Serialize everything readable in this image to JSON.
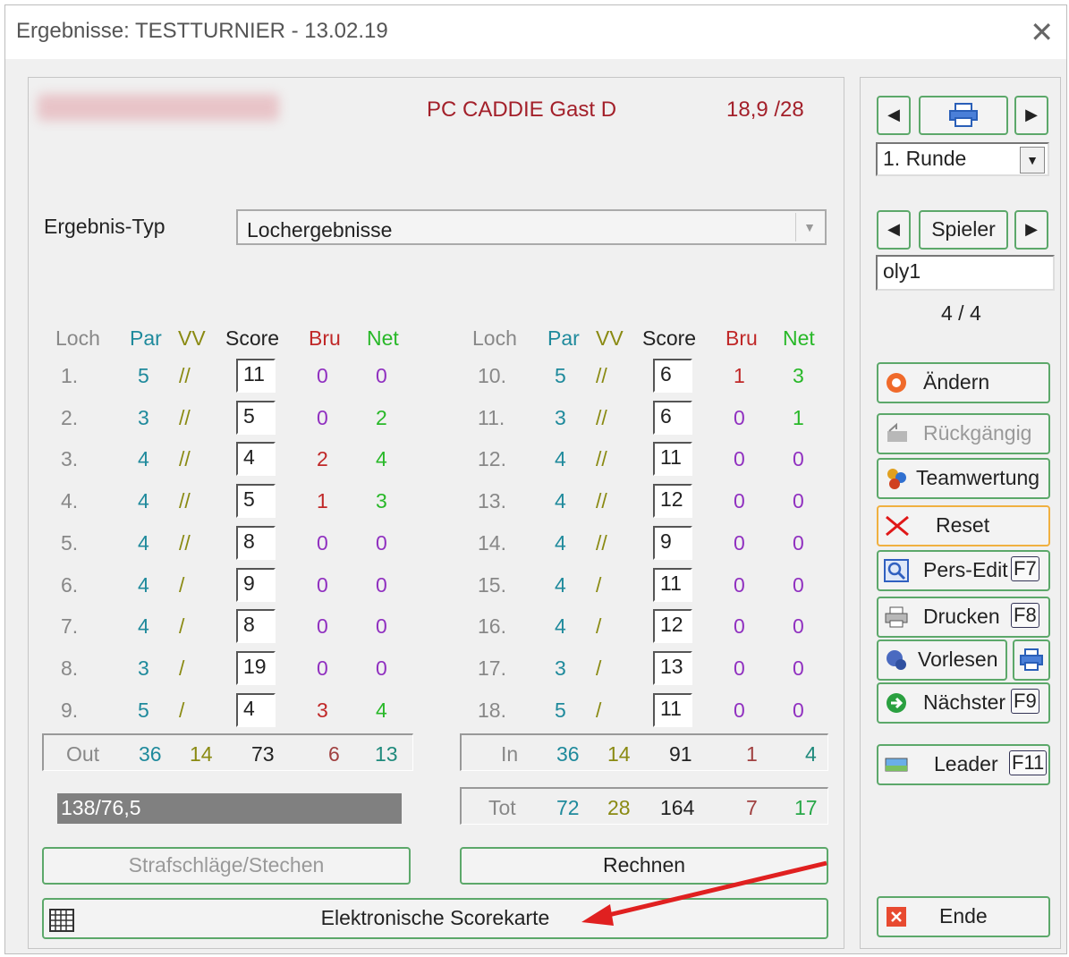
{
  "window": {
    "title": "Ergebnisse: TESTTURNIER - 13.02.19",
    "close_symbol": "✕"
  },
  "header": {
    "player_name": "PC CADDIE Gast D",
    "handicap": "18,9 /28"
  },
  "result_type": {
    "label": "Ergebnis-Typ",
    "value": "Lochergebnisse"
  },
  "columns": {
    "loch": "Loch",
    "par": "Par",
    "vv": "VV",
    "score": "Score",
    "bru": "Bru",
    "net": "Net"
  },
  "front_nine": [
    {
      "hole": "1.",
      "par": "5",
      "vv": "//",
      "score": "11",
      "bru": "0",
      "net": "0"
    },
    {
      "hole": "2.",
      "par": "3",
      "vv": "//",
      "score": "5",
      "bru": "0",
      "net": "2"
    },
    {
      "hole": "3.",
      "par": "4",
      "vv": "//",
      "score": "4",
      "bru": "2",
      "net": "4"
    },
    {
      "hole": "4.",
      "par": "4",
      "vv": "//",
      "score": "5",
      "bru": "1",
      "net": "3"
    },
    {
      "hole": "5.",
      "par": "4",
      "vv": "//",
      "score": "8",
      "bru": "0",
      "net": "0"
    },
    {
      "hole": "6.",
      "par": "4",
      "vv": "/",
      "score": "9",
      "bru": "0",
      "net": "0"
    },
    {
      "hole": "7.",
      "par": "4",
      "vv": "/",
      "score": "8",
      "bru": "0",
      "net": "0"
    },
    {
      "hole": "8.",
      "par": "3",
      "vv": "/",
      "score": "19",
      "bru": "0",
      "net": "0"
    },
    {
      "hole": "9.",
      "par": "5",
      "vv": "/",
      "score": "4",
      "bru": "3",
      "net": "4"
    }
  ],
  "back_nine": [
    {
      "hole": "10.",
      "par": "5",
      "vv": "//",
      "score": "6",
      "bru": "1",
      "net": "3"
    },
    {
      "hole": "11.",
      "par": "3",
      "vv": "//",
      "score": "6",
      "bru": "0",
      "net": "1"
    },
    {
      "hole": "12.",
      "par": "4",
      "vv": "//",
      "score": "11",
      "bru": "0",
      "net": "0"
    },
    {
      "hole": "13.",
      "par": "4",
      "vv": "//",
      "score": "12",
      "bru": "0",
      "net": "0"
    },
    {
      "hole": "14.",
      "par": "4",
      "vv": "//",
      "score": "9",
      "bru": "0",
      "net": "0"
    },
    {
      "hole": "15.",
      "par": "4",
      "vv": "/",
      "score": "11",
      "bru": "0",
      "net": "0"
    },
    {
      "hole": "16.",
      "par": "4",
      "vv": "/",
      "score": "12",
      "bru": "0",
      "net": "0"
    },
    {
      "hole": "17.",
      "par": "3",
      "vv": "/",
      "score": "13",
      "bru": "0",
      "net": "0"
    },
    {
      "hole": "18.",
      "par": "5",
      "vv": "/",
      "score": "11",
      "bru": "0",
      "net": "0"
    }
  ],
  "out_total": {
    "label": "Out",
    "par": "36",
    "vv": "14",
    "score": "73",
    "bru": "6",
    "net": "13"
  },
  "in_total": {
    "label": "In",
    "par": "36",
    "vv": "14",
    "score": "91",
    "bru": "1",
    "net": "4"
  },
  "grand_total": {
    "label": "Tot",
    "par": "72",
    "vv": "28",
    "score": "164",
    "bru": "7",
    "net": "17"
  },
  "summary_bar": "138/76,5",
  "buttons": {
    "strafschlaege": "Strafschläge/Stechen",
    "rechnen": "Rechnen",
    "scorekarte": "Elektronische Scorekarte"
  },
  "sidebar": {
    "round_select": "1. Runde",
    "player_label": "Spieler",
    "player_field": "oly1",
    "player_count": "4 / 4",
    "aendern": "Ändern",
    "rueckgaengig": "Rückgängig",
    "teamwertung": "Teamwertung",
    "reset": "Reset",
    "pers_edit": "Pers-Edit",
    "pers_edit_key": "F7",
    "drucken": "Drucken",
    "drucken_key": "F8",
    "vorlesen": "Vorlesen",
    "naechster": "Nächster",
    "naechster_key": "F9",
    "leader": "Leader",
    "leader_key": "F11",
    "ende": "Ende"
  },
  "colors": {
    "accent_border": "#5ca86a",
    "player_name": "#a3202a",
    "par": "#1f8a9c",
    "vv": "#8a8a12",
    "net": "#28b828",
    "bru": "#9030c0"
  }
}
